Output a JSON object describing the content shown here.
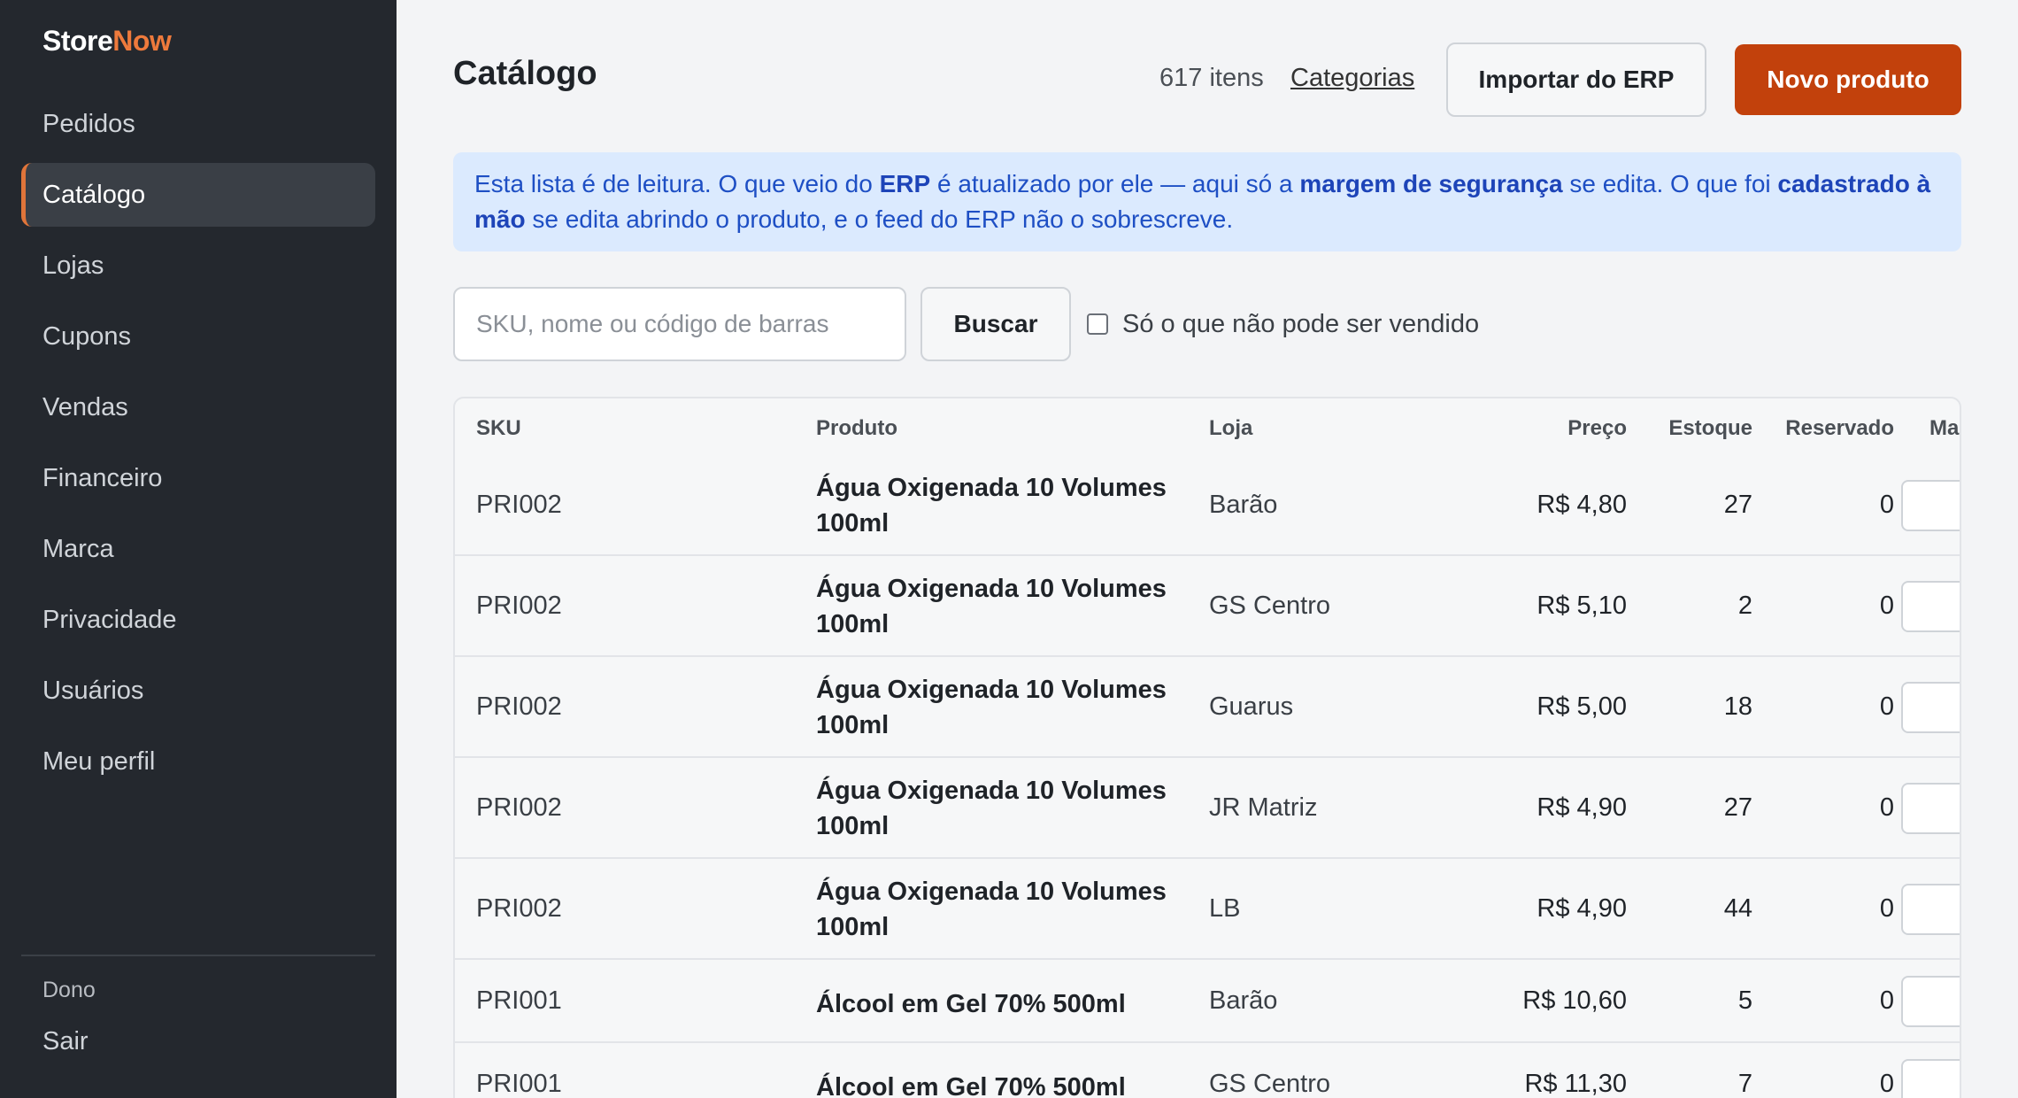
{
  "sidebar": {
    "brand_store": "Store",
    "brand_now": "Now",
    "items": [
      "Pedidos",
      "Catálogo",
      "Lojas",
      "Cupons",
      "Vendas",
      "Financeiro",
      "Marca",
      "Privacidade",
      "Usuários",
      "Meu perfil"
    ],
    "active_item": "Catálogo",
    "role": "Dono",
    "logout": "Sair"
  },
  "header": {
    "title": "Catálogo",
    "count": "617 itens",
    "categories_link": "Categorias",
    "import_button": "Importar do ERP",
    "new_button": "Novo produto"
  },
  "info": {
    "t1": "Esta lista é de leitura. O que veio do ",
    "b1": "ERP",
    "t2": " é atualizado por ele — aqui só a ",
    "b2": "margem de segurança",
    "t3": " se edita. O que foi ",
    "b3": "cadastrado à mão",
    "t4": " se edita abrindo o produto, e o feed do ERP não o sobrescreve."
  },
  "search": {
    "placeholder": "SKU, nome ou código de barras",
    "button": "Buscar",
    "filter_label": "Só o que não pode ser vendido"
  },
  "table": {
    "headers": {
      "sku": "SKU",
      "produto": "Produto",
      "loja": "Loja",
      "preco": "Preço",
      "estoque": "Estoque",
      "reservado": "Reservado",
      "margem": "Ma"
    },
    "rows": [
      {
        "sku": "PRI002",
        "produto": "Água Oxigenada 10 Volumes 100ml",
        "loja": "Barão",
        "preco": "R$ 4,80",
        "estoque": "27",
        "reservado": "0"
      },
      {
        "sku": "PRI002",
        "produto": "Água Oxigenada 10 Volumes 100ml",
        "loja": "GS Centro",
        "preco": "R$ 5,10",
        "estoque": "2",
        "reservado": "0"
      },
      {
        "sku": "PRI002",
        "produto": "Água Oxigenada 10 Volumes 100ml",
        "loja": "Guarus",
        "preco": "R$ 5,00",
        "estoque": "18",
        "reservado": "0"
      },
      {
        "sku": "PRI002",
        "produto": "Água Oxigenada 10 Volumes 100ml",
        "loja": "JR Matriz",
        "preco": "R$ 4,90",
        "estoque": "27",
        "reservado": "0"
      },
      {
        "sku": "PRI002",
        "produto": "Água Oxigenada 10 Volumes 100ml",
        "loja": "LB",
        "preco": "R$ 4,90",
        "estoque": "44",
        "reservado": "0"
      },
      {
        "sku": "PRI001",
        "produto": "Álcool em Gel 70% 500ml",
        "loja": "Barão",
        "preco": "R$ 10,60",
        "estoque": "5",
        "reservado": "0"
      },
      {
        "sku": "PRI001",
        "produto": "Álcool em Gel 70% 500ml",
        "loja": "GS Centro",
        "preco": "R$ 11,30",
        "estoque": "7",
        "reservado": "0"
      }
    ]
  }
}
